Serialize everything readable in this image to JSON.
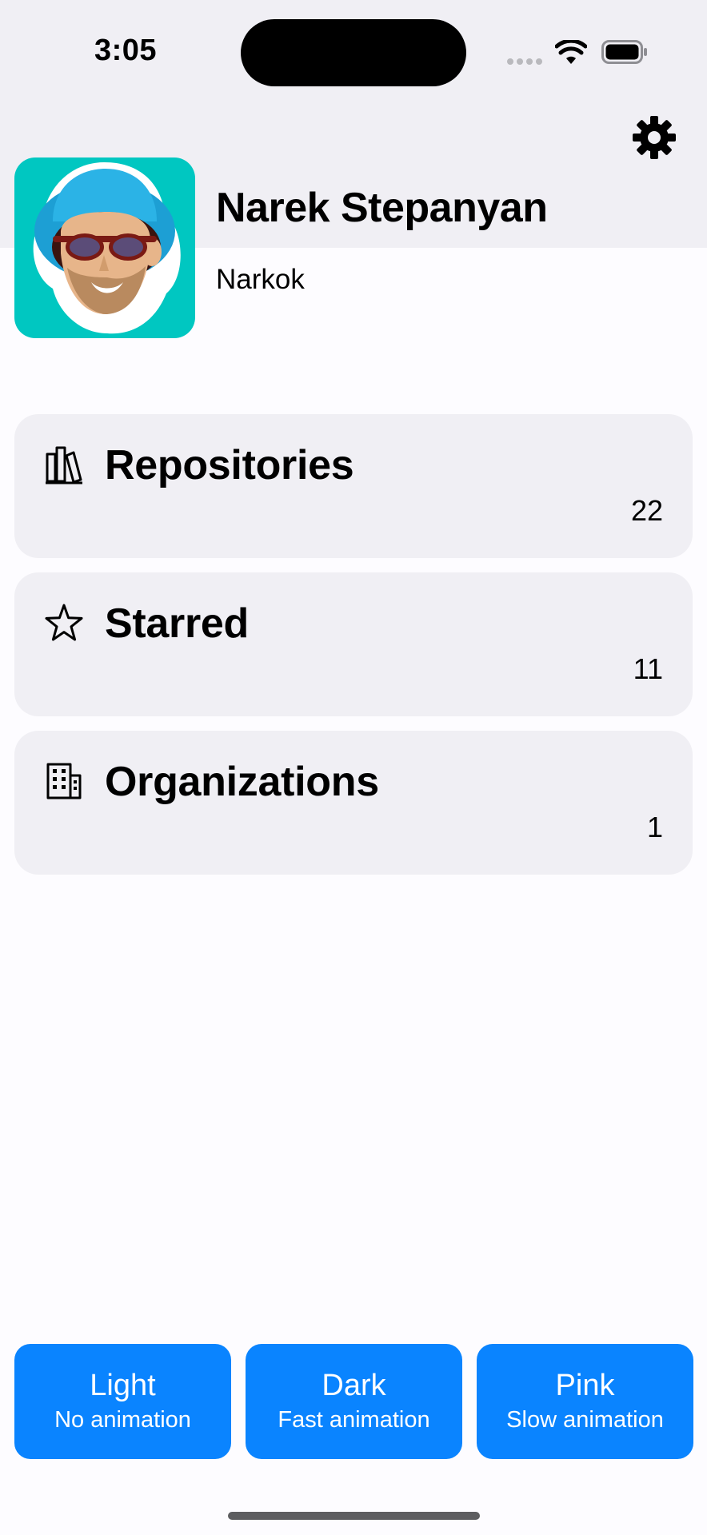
{
  "status_bar": {
    "time": "3:05",
    "icons": [
      "cellular-signal-icon",
      "wifi-icon",
      "battery-icon"
    ]
  },
  "header": {
    "settings_icon": "gear-icon"
  },
  "profile": {
    "name": "Narek Stepanyan",
    "username": "Narkok",
    "avatar_icon": "avatar-illustration"
  },
  "cards": [
    {
      "icon": "books-icon",
      "title": "Repositories",
      "count": "22"
    },
    {
      "icon": "star-icon",
      "title": "Starred",
      "count": "11"
    },
    {
      "icon": "building-icon",
      "title": "Organizations",
      "count": "1"
    }
  ],
  "theme_buttons": [
    {
      "title": "Light",
      "subtitle": "No animation"
    },
    {
      "title": "Dark",
      "subtitle": "Fast animation"
    },
    {
      "title": "Pink",
      "subtitle": "Slow animation"
    }
  ],
  "colors": {
    "accent": "#0a84ff",
    "card_bg": "#f0eff4",
    "page_bg": "#fdfcff",
    "avatar_bg": "#00c7c1"
  }
}
